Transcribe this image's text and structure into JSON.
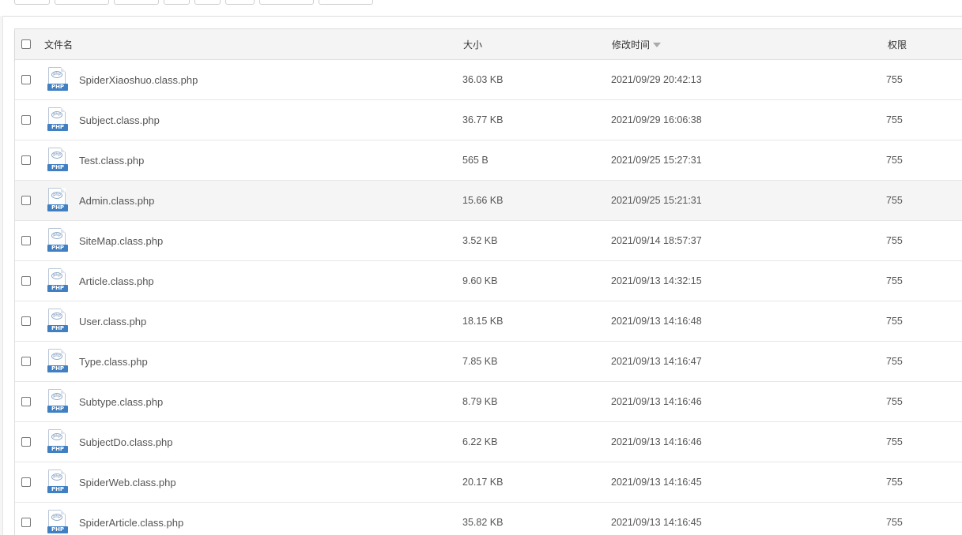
{
  "columns": {
    "name": "文件名",
    "size": "大小",
    "time": "修改时间",
    "perm": "权限"
  },
  "icon_tag": "PHP",
  "icon_glyph": "php",
  "rows": [
    {
      "name": "SpiderXiaoshuo.class.php",
      "size": "36.03 KB",
      "time": "2021/09/29 20:42:13",
      "perm": "755"
    },
    {
      "name": "Subject.class.php",
      "size": "36.77 KB",
      "time": "2021/09/29 16:06:38",
      "perm": "755"
    },
    {
      "name": "Test.class.php",
      "size": "565 B",
      "time": "2021/09/25 15:27:31",
      "perm": "755"
    },
    {
      "name": "Admin.class.php",
      "size": "15.66 KB",
      "time": "2021/09/25 15:21:31",
      "perm": "755"
    },
    {
      "name": "SiteMap.class.php",
      "size": "3.52 KB",
      "time": "2021/09/14 18:57:37",
      "perm": "755"
    },
    {
      "name": "Article.class.php",
      "size": "9.60 KB",
      "time": "2021/09/13 14:32:15",
      "perm": "755"
    },
    {
      "name": "User.class.php",
      "size": "18.15 KB",
      "time": "2021/09/13 14:16:48",
      "perm": "755"
    },
    {
      "name": "Type.class.php",
      "size": "7.85 KB",
      "time": "2021/09/13 14:16:47",
      "perm": "755"
    },
    {
      "name": "Subtype.class.php",
      "size": "8.79 KB",
      "time": "2021/09/13 14:16:46",
      "perm": "755"
    },
    {
      "name": "SubjectDo.class.php",
      "size": "6.22 KB",
      "time": "2021/09/13 14:16:46",
      "perm": "755"
    },
    {
      "name": "SpiderWeb.class.php",
      "size": "20.17 KB",
      "time": "2021/09/13 14:16:45",
      "perm": "755"
    },
    {
      "name": "SpiderArticle.class.php",
      "size": "35.82 KB",
      "time": "2021/09/13 14:16:45",
      "perm": "755"
    }
  ]
}
